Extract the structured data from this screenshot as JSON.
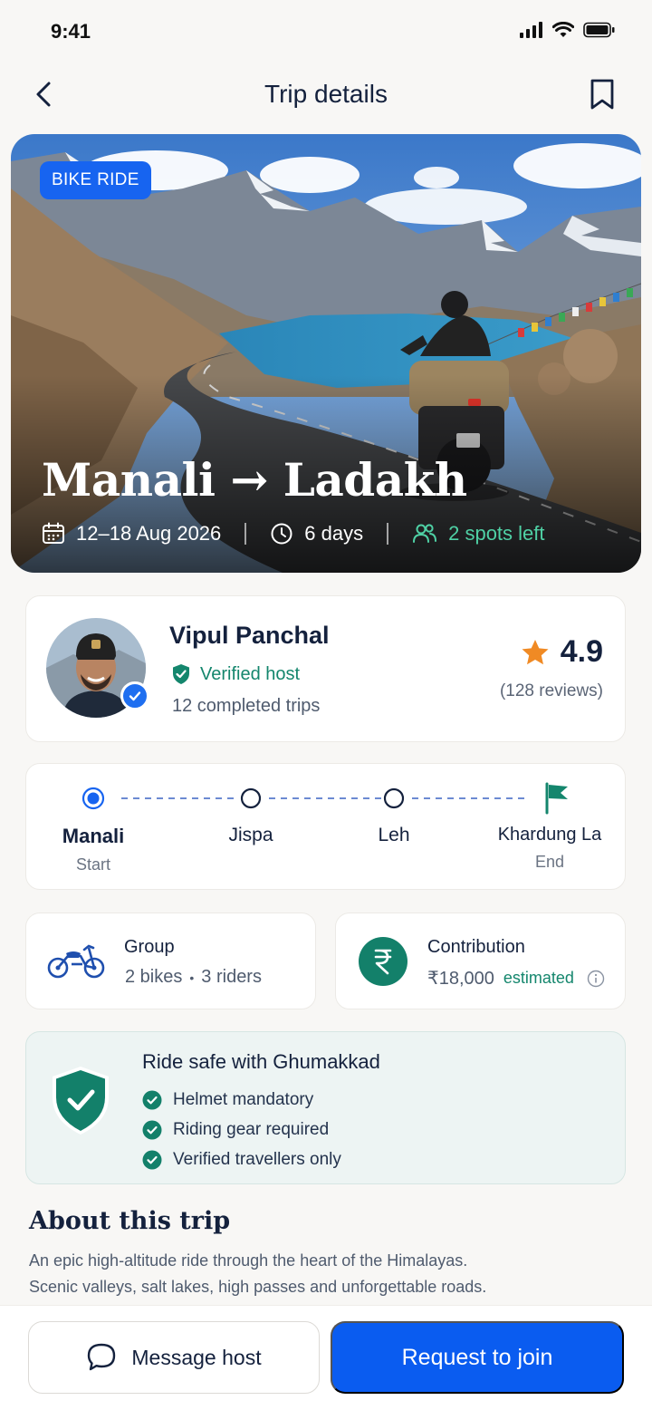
{
  "status_bar": {
    "time": "9:41"
  },
  "header": {
    "title": "Trip details"
  },
  "hero": {
    "badge": "BIKE RIDE",
    "route_title": "Manali → Ladakh",
    "dates": "12–18 Aug 2026",
    "duration": "6 days",
    "spots": "2 spots left"
  },
  "host": {
    "name": "Vipul Panchal",
    "verified_label": "Verified host",
    "completed_trips": "12 completed trips",
    "rating": "4.9",
    "reviews": "(128 reviews)"
  },
  "route": {
    "stops": [
      {
        "name": "Manali",
        "sub": "Start"
      },
      {
        "name": "Jispa",
        "sub": ""
      },
      {
        "name": "Leh",
        "sub": ""
      },
      {
        "name": "Khardung La",
        "sub": "End"
      }
    ]
  },
  "group": {
    "title": "Group",
    "bikes": "2 bikes",
    "riders": "3 riders"
  },
  "contribution": {
    "title": "Contribution",
    "amount": "₹18,000",
    "note": "estimated"
  },
  "safety": {
    "title": "Ride safe with Ghumakkad",
    "items": [
      "Helmet mandatory",
      "Riding gear required",
      "Verified travellers only"
    ]
  },
  "about": {
    "title": "About this trip",
    "line1": "An epic high-altitude ride through the heart of the Himalayas.",
    "line2": "Scenic valleys, salt lakes, high passes and unforgettable roads."
  },
  "actions": {
    "message": "Message host",
    "join": "Request to join"
  },
  "colors": {
    "primary": "#0a5cf0",
    "teal": "#14866d",
    "star": "#f08a24"
  }
}
